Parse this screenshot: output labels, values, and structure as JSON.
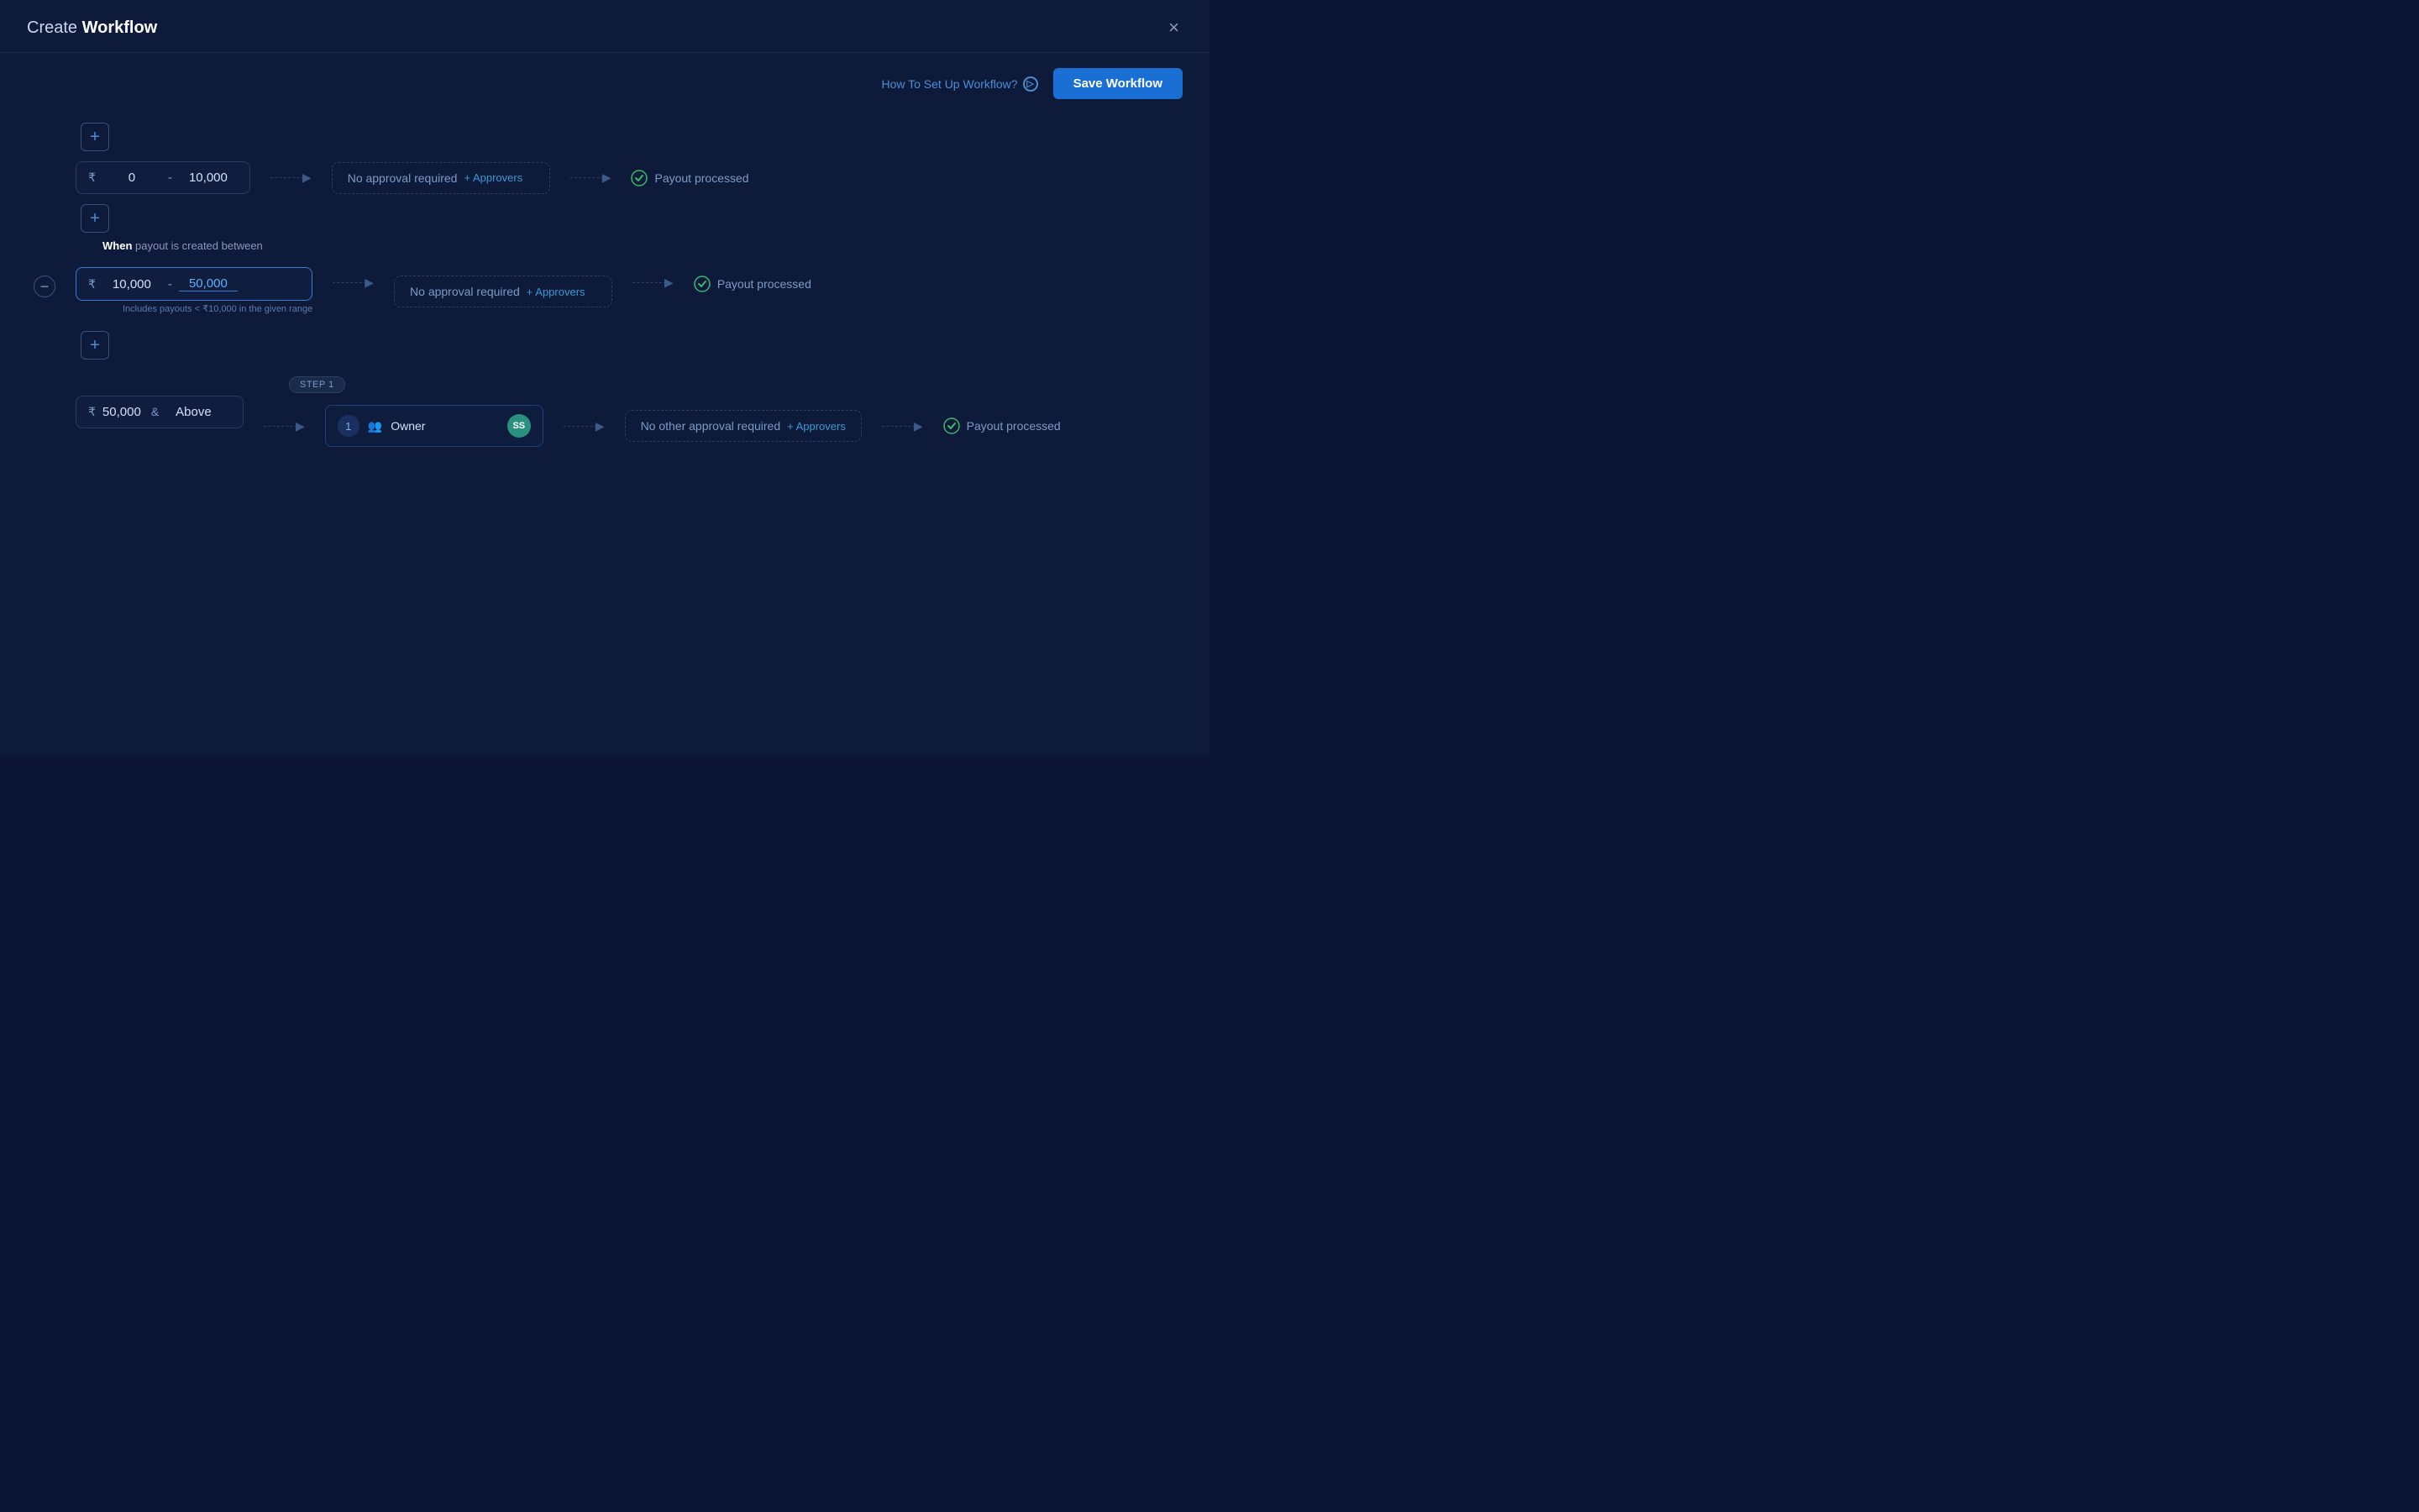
{
  "modal": {
    "title_prefix": "Create ",
    "title_bold": "Workflow",
    "close_label": "×"
  },
  "toolbar": {
    "help_text": "How To Set Up Workflow?",
    "save_label": "Save Workflow"
  },
  "rows": [
    {
      "id": "row1",
      "type": "simple",
      "range_min": "0",
      "range_max": "10,000",
      "approval": "No approval required",
      "add_approvers": "+ Approvers",
      "payout": "Payout processed"
    },
    {
      "id": "row2",
      "type": "with_label",
      "when_text": "payout is created between",
      "range_min": "10,000",
      "range_max": "50,000",
      "approval": "No approval required",
      "add_approvers": "+ Approvers",
      "payout": "Payout processed",
      "hint": "Includes payouts < ₹10,000 in the given range"
    },
    {
      "id": "row3",
      "type": "above_with_step",
      "range_value": "50,000",
      "step_label": "STEP 1",
      "approver_count": "1",
      "approver_role": "Owner",
      "avatar": "SS",
      "no_other": "No other approval required",
      "add_approvers": "+ Approvers",
      "payout": "Payout processed"
    }
  ],
  "labels": {
    "when": "When",
    "above": "Above",
    "and": "&",
    "currency": "₹",
    "dash": "-"
  }
}
